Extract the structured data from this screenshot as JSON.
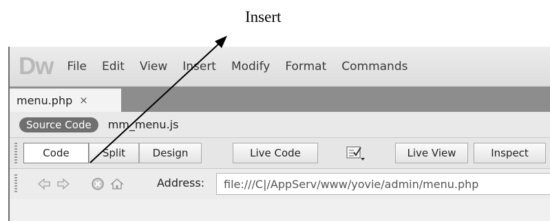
{
  "annotation": {
    "label": "Insert"
  },
  "app": {
    "logo": "Dw"
  },
  "menubar": {
    "items": [
      "File",
      "Edit",
      "View",
      "Insert",
      "Modify",
      "Format",
      "Commands"
    ]
  },
  "document_tab": {
    "name": "menu.php",
    "close": "×"
  },
  "related_files": {
    "source": "Source Code",
    "file": "mm_menu.js"
  },
  "toolbar": {
    "code": "Code",
    "split": "Split",
    "design": "Design",
    "live_code": "Live Code",
    "live_view": "Live View",
    "inspect": "Inspect"
  },
  "address": {
    "label": "Address:",
    "value": "file:///C|/AppServ/www/yovie/admin/menu.php"
  },
  "colors": {
    "logo": "#b9b9b9",
    "tab_strip": "#8d8d8d",
    "pill": "#6f6f6f"
  }
}
